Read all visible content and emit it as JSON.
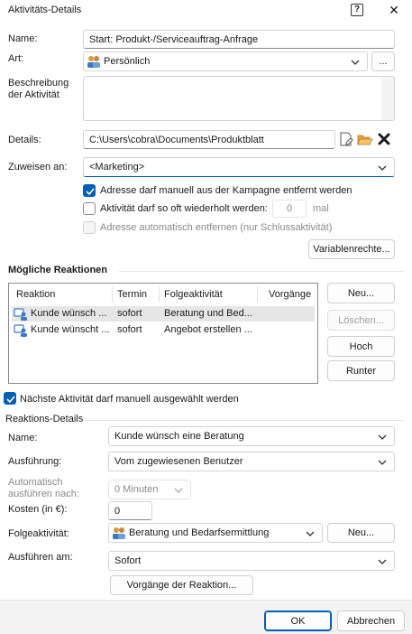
{
  "window": {
    "title": "Aktivitäts-Details",
    "help_glyph": "?",
    "close_glyph": "✕"
  },
  "form": {
    "name_label": "Name:",
    "name_value": "Start: Produkt-/Serviceauftrag-Anfrage",
    "art_label": "Art:",
    "art_value": "Persönlich",
    "art_more": "...",
    "desc_label_1": "Beschreibung",
    "desc_label_2": "der Aktivität",
    "desc_value": "",
    "details_label": "Details:",
    "details_value": "C:\\Users\\cobra\\Documents\\Produktblatt",
    "assign_label": "Zuweisen an:",
    "assign_value": "<Marketing>",
    "chk_remove_label": "Adresse darf manuell aus der Kampagne entfernt werden",
    "chk_repeat_label": "Aktivität darf so oft wiederholt werden:",
    "repeat_value": "0",
    "repeat_unit": "mal",
    "chk_auto_label": "Adresse automatisch entfernen (nur Schlussaktivität)",
    "variables_button": "Variablenrechte..."
  },
  "reactions": {
    "title": "Mögliche Reaktionen",
    "columns": [
      "Reaktion",
      "Termin",
      "Folgeaktivität",
      "Vorgänge"
    ],
    "rows": [
      {
        "reaktion": "Kunde wünsch ...",
        "termin": "sofort",
        "folge": "Beratung und Bed...",
        "vorgaenge": ""
      },
      {
        "reaktion": "Kunde wünscht ...",
        "termin": "sofort",
        "folge": "Angebot erstellen ...",
        "vorgaenge": ""
      }
    ],
    "buttons": {
      "new": "Neu...",
      "delete": "Löschen...",
      "up": "Hoch",
      "down": "Runter"
    },
    "chk_next_label": "Nächste Aktivität darf manuell ausgewählt werden"
  },
  "reaction_details": {
    "title": "Reaktions-Details",
    "name_label": "Name:",
    "name_value": "Kunde wünsch eine Beratung",
    "exec_label": "Ausführung:",
    "exec_value": "Vom zugewiesenen Benutzer",
    "auto_label_1": "Automatisch",
    "auto_label_2": "ausführen nach:",
    "auto_value": "0 Minuten",
    "cost_label": "Kosten (in €):",
    "cost_value": "0",
    "follow_label": "Folgeaktivität:",
    "follow_value": "Beratung und Bedarfsermittlung",
    "follow_new": "Neu...",
    "run_label": "Ausführen am:",
    "run_value": "Sofort",
    "processes_button": "Vorgänge der Reaktion..."
  },
  "footer": {
    "ok": "OK",
    "cancel": "Abbrechen"
  },
  "colors": {
    "accent": "#005fb8",
    "border": "#d4d4d4",
    "selection": "#e6e6e6",
    "footer_bg": "#f3f3f3",
    "delete_x": "#1a1a1a",
    "folder": "#e8a33d"
  }
}
